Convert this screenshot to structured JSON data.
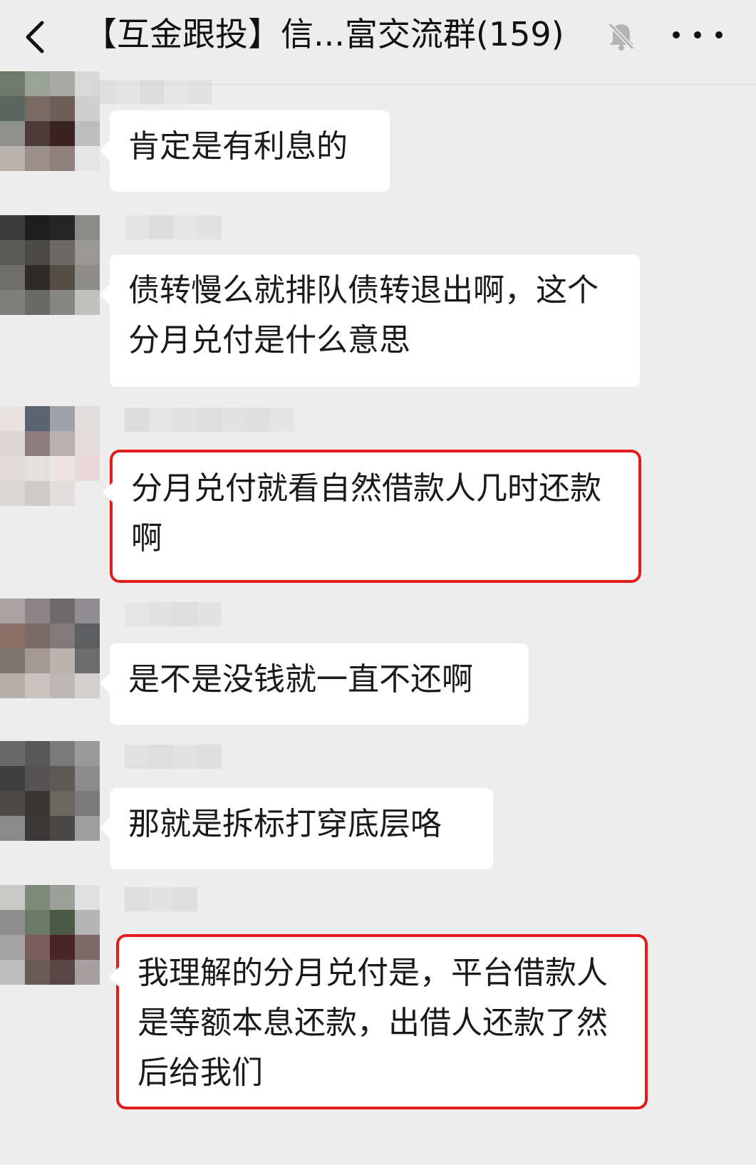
{
  "header": {
    "back_icon": "chevron-left-icon",
    "title": "【互金跟投】信...富交流群(159)",
    "mute_icon": "bell-muted-icon",
    "more_icon": "more-dots-icon"
  },
  "messages": [
    {
      "text": "肯定是有利息的",
      "highlighted": false
    },
    {
      "text": "债转慢么就排队债转退出啊，这个分月兑付是什么意思",
      "highlighted": false
    },
    {
      "text": "分月兑付就看自然借款人几时还款啊",
      "highlighted": true
    },
    {
      "text": "是不是没钱就一直不还啊",
      "highlighted": false
    },
    {
      "text": "那就是拆标打穿底层咯",
      "highlighted": false
    },
    {
      "text": "我理解的分月兑付是，平台借款人是等额本息还款，出借人还款了然后给我们",
      "highlighted": true
    }
  ],
  "colors": {
    "background": "#ededed",
    "bubble": "#ffffff",
    "highlight_border": "#e21b1b"
  }
}
